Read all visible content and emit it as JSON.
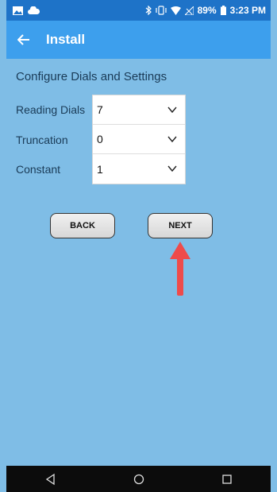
{
  "status": {
    "battery": "89%",
    "time": "3:23 PM"
  },
  "appbar": {
    "title": "Install"
  },
  "section": {
    "heading": "Configure Dials and Settings"
  },
  "settings": [
    {
      "label": "Reading Dials",
      "value": "7"
    },
    {
      "label": "Truncation",
      "value": "0"
    },
    {
      "label": "Constant",
      "value": "1"
    }
  ],
  "buttons": {
    "back": "BACK",
    "next": "NEXT"
  },
  "colors": {
    "status_bar": "#1e73c8",
    "app_bar": "#3d9fed",
    "background": "#7fbde6",
    "arrow": "#ee4b4b",
    "nav_bar": "#0c0c0c"
  },
  "icons": [
    "gallery-icon",
    "cloud-icon",
    "bluetooth-icon",
    "vibrate-icon",
    "wifi-icon",
    "signal-icon",
    "battery-icon",
    "back-arrow-icon",
    "chevron-down-icon",
    "nav-back-icon",
    "nav-home-icon",
    "nav-recents-icon"
  ]
}
